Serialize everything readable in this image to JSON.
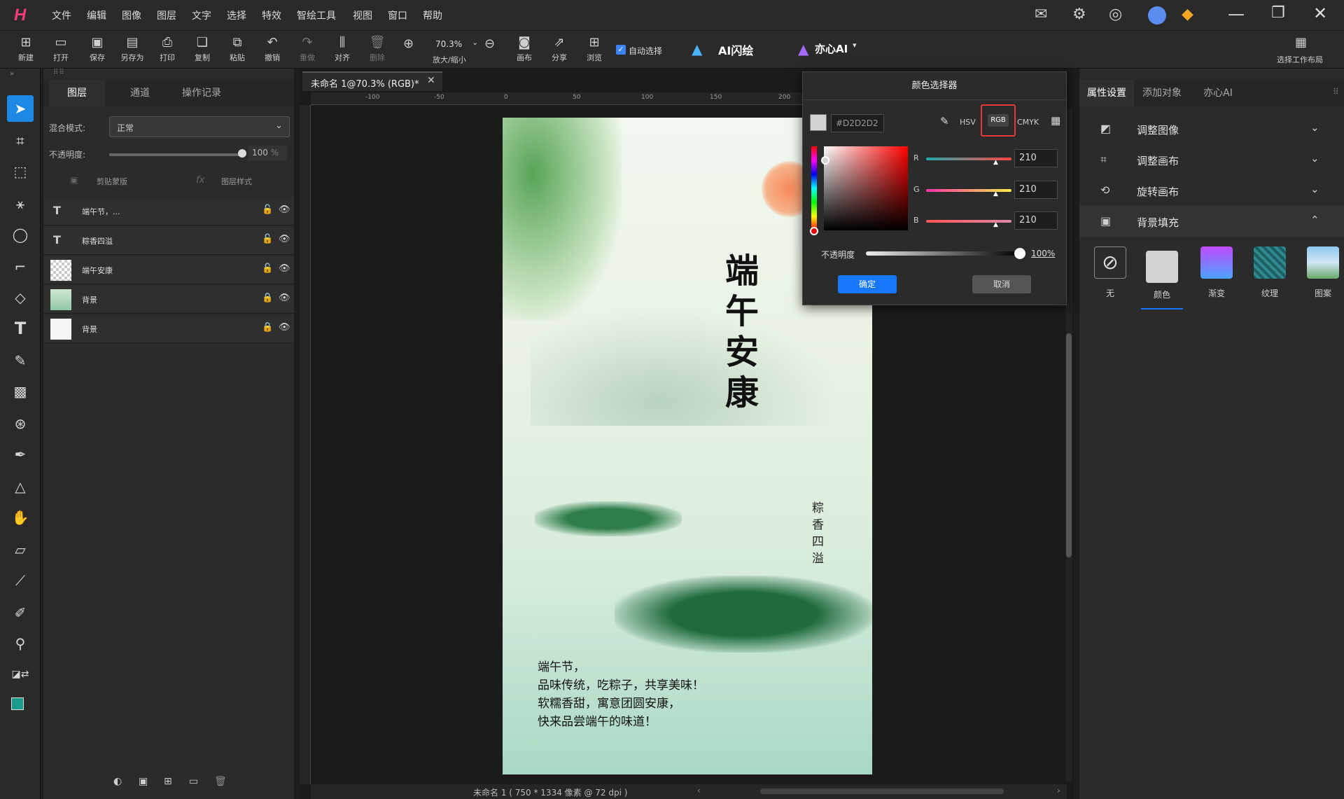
{
  "menu": {
    "items": [
      "文件",
      "编辑",
      "图像",
      "图层",
      "文字",
      "选择",
      "特效",
      "智绘工具",
      "视图",
      "窗口",
      "帮助"
    ]
  },
  "toolbar": {
    "buttons": [
      "新建",
      "打开",
      "保存",
      "另存为",
      "打印",
      "复制",
      "粘贴",
      "撤销",
      "重做",
      "对齐",
      "删除"
    ],
    "zoom_value": "70.3%",
    "zoom_label": "放大/缩小",
    "more": [
      "画布",
      "分享",
      "浏览"
    ],
    "auto_select": "自动选择",
    "ai_flash": "AI闪绘",
    "yixin_ai": "亦心AI",
    "select_layout": "选择工作布局"
  },
  "layers": {
    "tabs": [
      "图层",
      "通道",
      "操作记录"
    ],
    "blend_label": "混合模式:",
    "blend_value": "正常",
    "opacity_label": "不透明度:",
    "opacity_value": "100",
    "opacity_unit": "%",
    "clip_mask": "剪贴蒙版",
    "layer_style": "图层样式",
    "fx": "fx",
    "items": [
      {
        "name": "端午节，..."
      },
      {
        "name": "粽香四溢"
      },
      {
        "name": "端午安康"
      },
      {
        "name": "背景"
      },
      {
        "name": "背景"
      }
    ]
  },
  "document": {
    "tab": "未命名 1@70.3% (RGB)*",
    "status": "未命名 1 ( 750 * 1334 像素 @ 72 dpi )",
    "ruler_labels": [
      "-100",
      "-50",
      "0",
      "50",
      "100",
      "150",
      "200"
    ],
    "title_chars": [
      "端",
      "午",
      "安",
      "康"
    ],
    "side_chars": [
      "粽",
      "香",
      "四",
      "溢"
    ],
    "poem": [
      "端午节，",
      "品味传统，吃粽子，共享美味！",
      "软糯香甜，寓意团圆安康，",
      "快来品尝端午的味道！"
    ]
  },
  "color_picker": {
    "title": "颜色选择器",
    "hex": "#D2D2D2",
    "modes": [
      "HSV",
      "RGB",
      "CMYK"
    ],
    "active_mode": "RGB",
    "r_label": "R",
    "g_label": "G",
    "b_label": "B",
    "r": "210",
    "g": "210",
    "b": "210",
    "opacity_label": "不透明度",
    "opacity": "100%",
    "ok": "确定",
    "cancel": "取消",
    "swatch_color": "#D2D2D2"
  },
  "right_panel": {
    "tabs": [
      "属性设置",
      "添加对象",
      "亦心AI"
    ],
    "sections": [
      "调整图像",
      "调整画布",
      "旋转画布",
      "背景填充"
    ],
    "fill_options": [
      "无",
      "颜色",
      "渐变",
      "纹理",
      "图案"
    ],
    "selected_fill": "颜色"
  }
}
